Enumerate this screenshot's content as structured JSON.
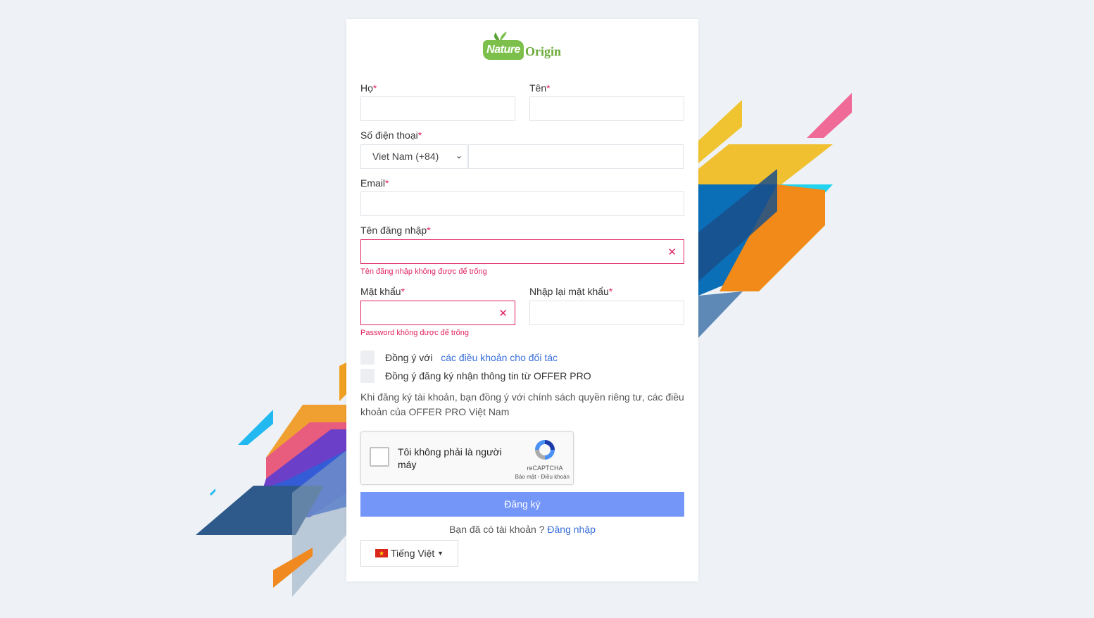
{
  "brand": {
    "logo_left": "Nature",
    "logo_right": "Origin"
  },
  "form": {
    "last_name_label": "Họ",
    "first_name_label": "Tên",
    "phone_label": "Số điện thoại",
    "country_select": "Viet Nam (+84)",
    "email_label": "Email",
    "username_label": "Tên đăng nhập",
    "username_error": "Tên đăng nhập không được để trống",
    "password_label": "Mật khẩu",
    "password_error": "Password không được để trống",
    "confirm_password_label": "Nhập lại mật khẩu",
    "required_mark": "*",
    "clear_icon": "✕"
  },
  "agreements": {
    "terms_prefix": "Đồng ý với",
    "terms_link": "các điều khoản cho đối tác",
    "newsletter": "Đồng ý đăng ký nhận thông tin từ OFFER PRO"
  },
  "policy_text": "Khi đăng ký tài khoản, bạn đồng ý với chính sách quyền riêng tư, các điều khoản của OFFER PRO Việt Nam",
  "recaptcha": {
    "label": "Tôi không phải là người máy",
    "brand": "reCAPTCHA",
    "links": "Bảo mật - Điều khoản"
  },
  "submit_label": "Đăng ký",
  "login_prompt": "Bạn đã có tài khoản ?",
  "login_link": "Đăng nhập",
  "language": {
    "label": "Tiếng Việt"
  },
  "colors": {
    "accent": "#7496f8",
    "error": "#e0245e",
    "link": "#3a6fd8",
    "brand_green": "#7cc04b"
  }
}
